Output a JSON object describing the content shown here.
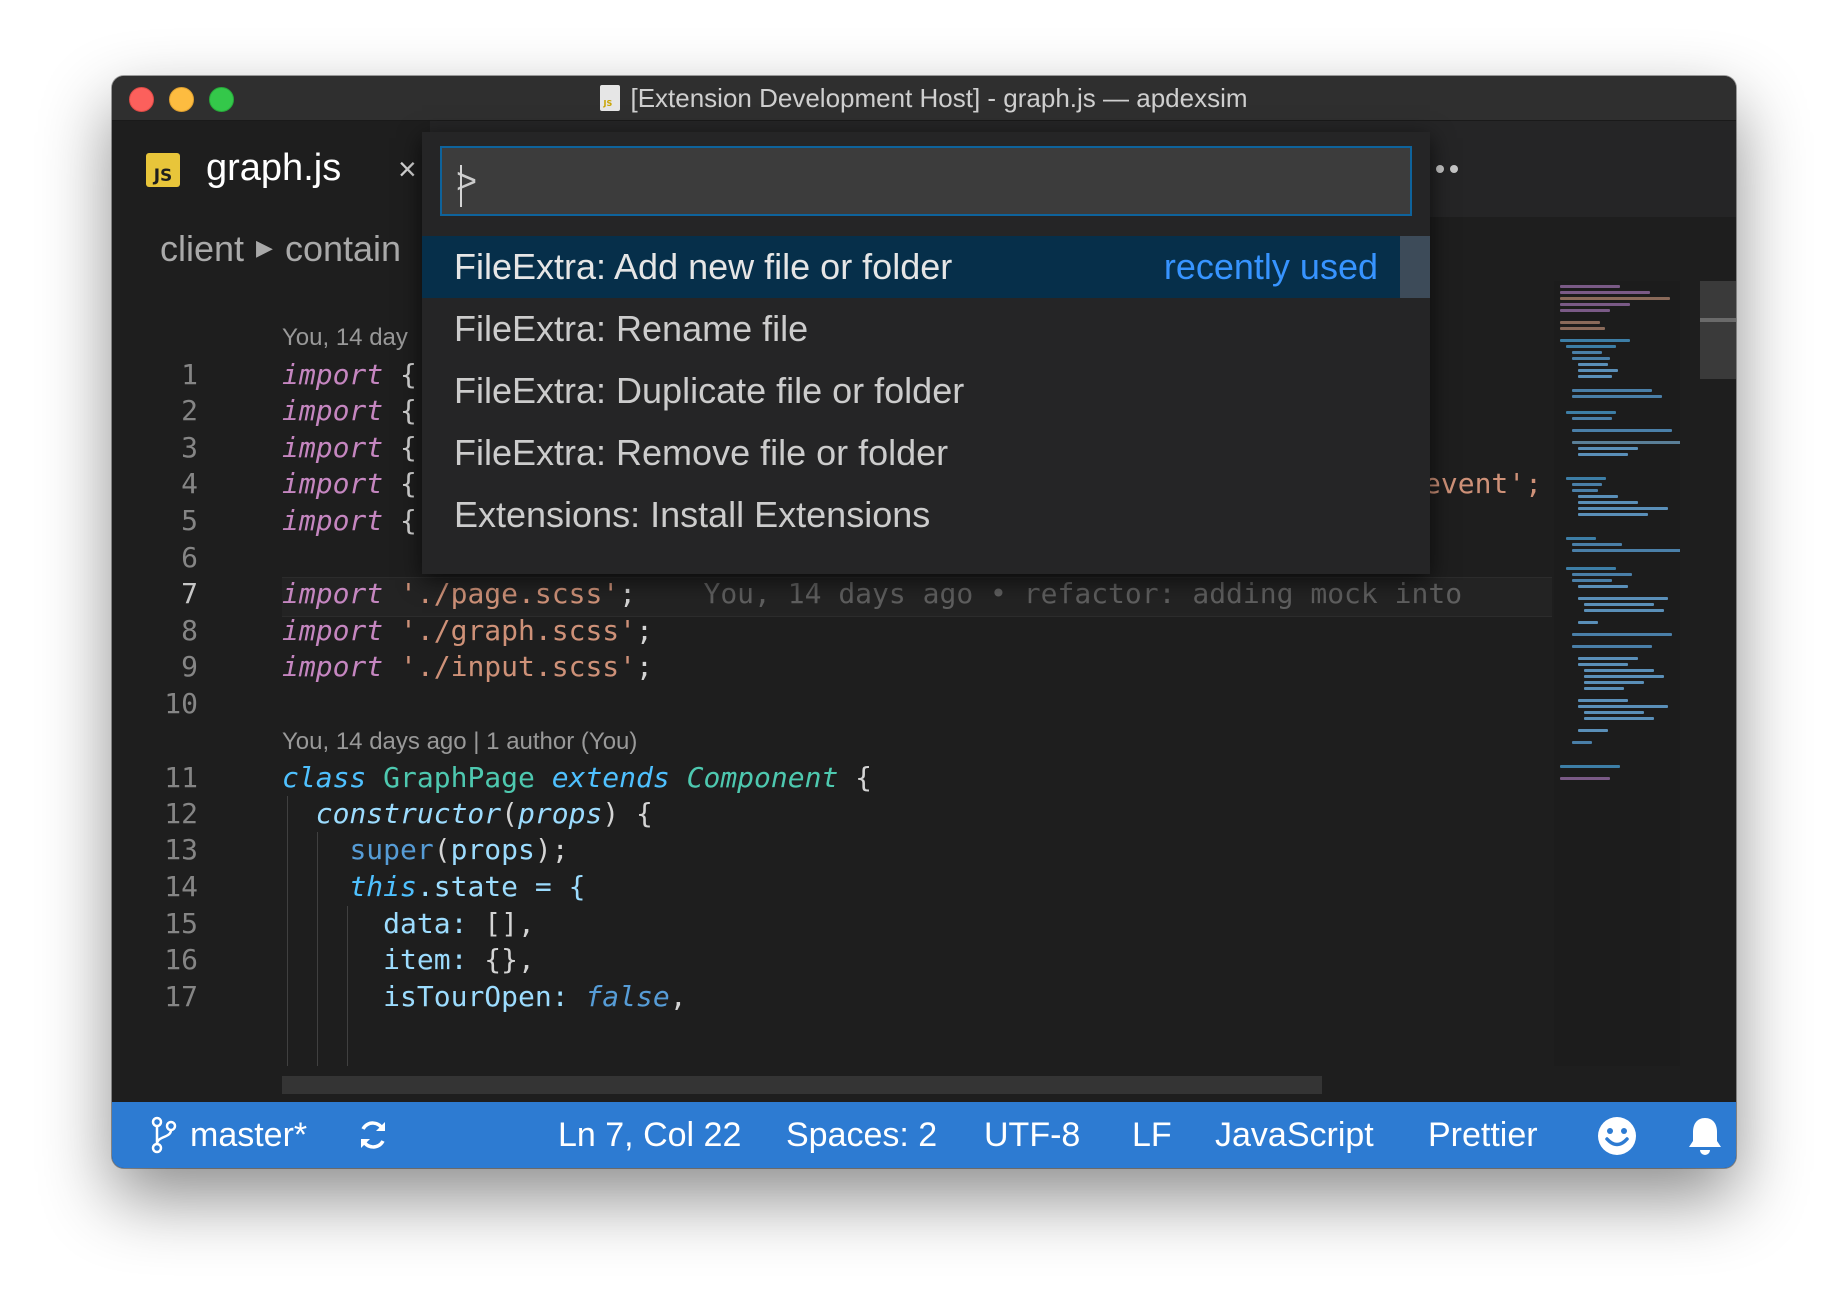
{
  "window": {
    "title": "[Extension Development Host] - graph.js — apdexsim"
  },
  "tab": {
    "label": "graph.js",
    "icon": "JS",
    "close": "×"
  },
  "breadcrumb": [
    "client",
    "contain"
  ],
  "command_palette": {
    "input_value": ">",
    "items": [
      {
        "label": "FileExtra: Add new file or folder",
        "hint": "recently used"
      },
      {
        "label": "FileExtra: Rename file"
      },
      {
        "label": "FileExtra: Duplicate file or folder"
      },
      {
        "label": "FileExtra: Remove file or folder"
      },
      {
        "label": "Extensions: Install Extensions"
      }
    ]
  },
  "editor": {
    "codelens_top": "You, 14 day",
    "codelens_class": "You, 14 days ago | 1 author (You)",
    "line_numbers": [
      "1",
      "2",
      "3",
      "4",
      "5",
      "6",
      "7",
      "8",
      "9",
      "10",
      "11",
      "12",
      "13",
      "14",
      "15",
      "16",
      "17"
    ],
    "fragments": {
      "paren": ")",
      "event_tail": "event';",
      "brace": "{"
    },
    "lines": {
      "l7_str": "'./page.scss'",
      "l7_blame": "You, 14 days ago • refactor: adding mock into",
      "l8_str": "'./graph.scss'",
      "l9_str": "'./input.scss'",
      "kw_import": "import",
      "kw_class": "class",
      "class_name": "GraphPage",
      "kw_extends": "extends",
      "base_class": "Component",
      "constructor": "constructor",
      "props": "props",
      "super": "super",
      "this": "this",
      "state": ".state = {",
      "data_key": "data:",
      "data_val": " [],",
      "item_key": "item:",
      "item_val": " {},",
      "tour_key": "isTourOpen:",
      "tour_val": "false"
    }
  },
  "status_bar": {
    "branch": "master*",
    "position": "Ln 7, Col 22",
    "spaces": "Spaces: 2",
    "encoding": "UTF-8",
    "eol": "LF",
    "language": "JavaScript",
    "formatter": "Prettier"
  },
  "colors": {
    "status_bar": "#2d7bd2",
    "palette_selection": "#062f4a",
    "hint": "#3794ff",
    "keyword": "#c586c0",
    "string": "#ce9178"
  }
}
